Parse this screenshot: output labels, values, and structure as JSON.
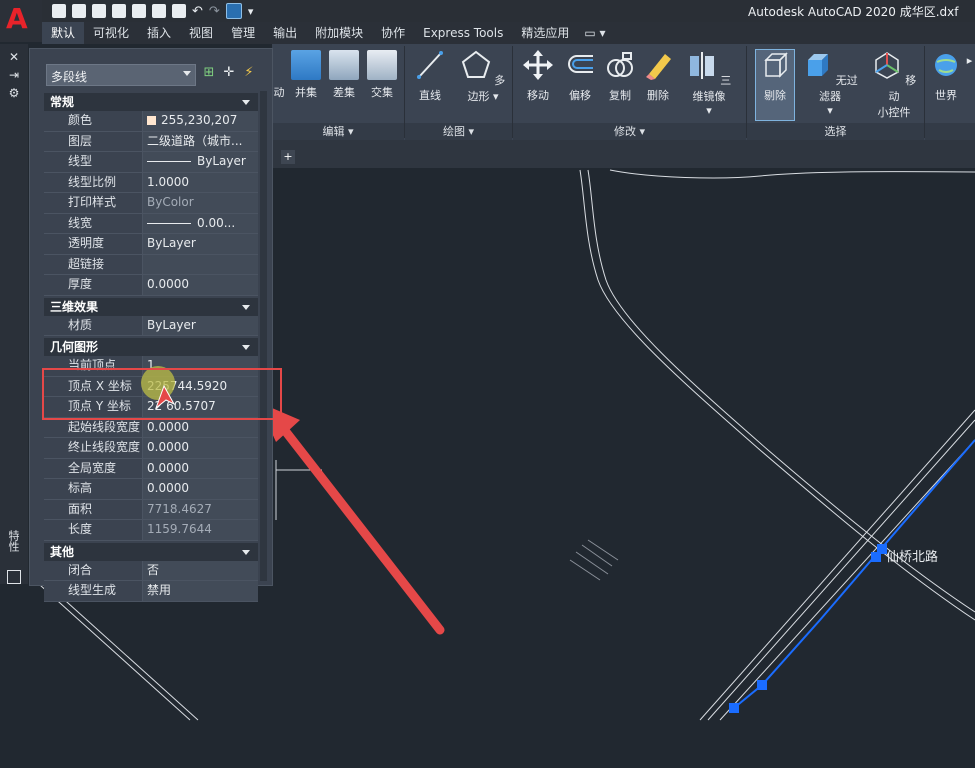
{
  "app": {
    "title": "Autodesk AutoCAD 2020    成华区.dxf"
  },
  "tabs": [
    "默认",
    "可视化",
    "插入",
    "视图",
    "管理",
    "输出",
    "附加模块",
    "协作",
    "Express Tools",
    "精选应用"
  ],
  "ribbon": {
    "buttons": {
      "move_partial": "动",
      "union": "并集",
      "subtract": "差集",
      "intersect": "交集",
      "line": "直线",
      "polygon": "多边形",
      "move": "移动",
      "offset": "偏移",
      "copy": "复制",
      "erase": "删除",
      "mirror3d": "三维镜像",
      "cull": "剔除",
      "no_filter": "无过滤器",
      "move_gizmo_1": "移动",
      "move_gizmo_2": "小控件",
      "world": "世界"
    },
    "panels": {
      "edit": "编辑 ▾",
      "draw": "绘图 ▾",
      "modify": "修改 ▾",
      "select": "选择"
    }
  },
  "properties": {
    "selection": "多段线",
    "sections": [
      {
        "title": "常规",
        "rows": [
          {
            "k": "颜色",
            "v": "255,230,207",
            "type": "color"
          },
          {
            "k": "图层",
            "v": "二级道路（城市..."
          },
          {
            "k": "线型",
            "v": "ByLayer",
            "type": "line"
          },
          {
            "k": "线型比例",
            "v": "1.0000"
          },
          {
            "k": "打印样式",
            "v": "ByColor",
            "dim": true
          },
          {
            "k": "线宽",
            "v": "0.00...",
            "type": "line"
          },
          {
            "k": "透明度",
            "v": "ByLayer"
          },
          {
            "k": "超链接",
            "v": ""
          },
          {
            "k": "厚度",
            "v": "0.0000"
          }
        ]
      },
      {
        "title": "三维效果",
        "rows": [
          {
            "k": "材质",
            "v": "ByLayer"
          }
        ]
      },
      {
        "title": "几何图形",
        "rows": [
          {
            "k": "当前顶点",
            "v": "1"
          },
          {
            "k": "顶点 X 坐标",
            "v": "225744.5920"
          },
          {
            "k": "顶点 Y 坐标",
            "v": "22 60.5707"
          },
          {
            "k": "起始线段宽度",
            "v": "0.0000"
          },
          {
            "k": "终止线段宽度",
            "v": "0.0000"
          },
          {
            "k": "全局宽度",
            "v": "0.0000"
          },
          {
            "k": "标高",
            "v": "0.0000"
          },
          {
            "k": "面积",
            "v": "7718.4627",
            "dim": true
          },
          {
            "k": "长度",
            "v": "1159.7644",
            "dim": true
          }
        ]
      },
      {
        "title": "其他",
        "rows": [
          {
            "k": "闭合",
            "v": "否"
          },
          {
            "k": "线型生成",
            "v": "禁用"
          }
        ]
      }
    ]
  },
  "side_label": "特性",
  "drawing": {
    "street_label": "仙桥北路",
    "highlight_color": "#e54848",
    "selection_color": "#1a6cff"
  }
}
